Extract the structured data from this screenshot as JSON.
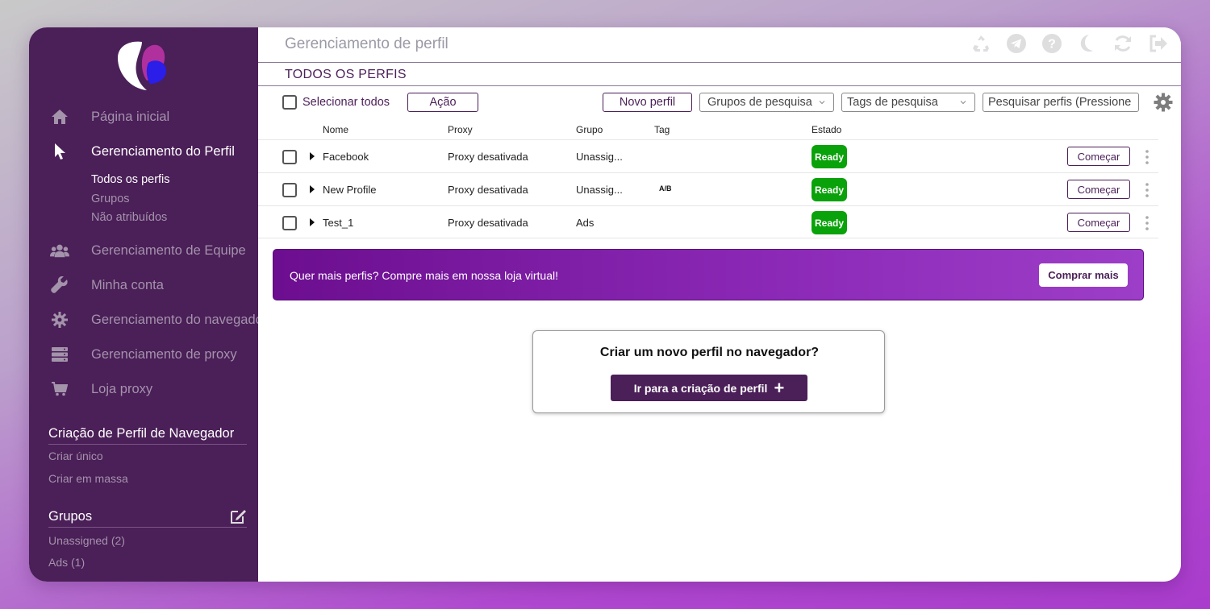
{
  "sidebar": {
    "nav": [
      {
        "label": "Página inicial",
        "icon": "home-icon"
      },
      {
        "label": "Gerenciamento do Perfil",
        "icon": "cursor-icon"
      },
      {
        "label": "Gerenciamento de Equipe",
        "icon": "team-icon"
      },
      {
        "label": "Minha conta",
        "icon": "wrench-icon"
      },
      {
        "label": "Gerenciamento do navegador",
        "icon": "gear-icon"
      },
      {
        "label": "Gerenciamento de proxy",
        "icon": "server-icon"
      },
      {
        "label": "Loja proxy",
        "icon": "cart-icon"
      }
    ],
    "profile_sub": [
      "Todos os perfis",
      "Grupos",
      "Não atribuídos"
    ],
    "create_section": {
      "title": "Criação de Perfil de Navegador",
      "items": [
        "Criar único",
        "Criar em massa"
      ]
    },
    "groups_section": {
      "title": "Grupos",
      "items": [
        "Unassigned (2)",
        "Ads (1)"
      ]
    }
  },
  "header": {
    "title": "Gerenciamento de perfil",
    "section": "TODOS OS PERFIS"
  },
  "toolbar": {
    "select_all": "Selecionar todos",
    "action": "Ação",
    "new_profile": "Novo perfil",
    "search_groups": "Grupos de pesquisa",
    "search_tags": "Tags de pesquisa",
    "search_placeholder": "Pesquisar perfis (Pressione /)"
  },
  "table": {
    "columns": [
      "Nome",
      "Proxy",
      "Grupo",
      "Tag",
      "Estado"
    ],
    "rows": [
      {
        "name": "Facebook",
        "proxy": "Proxy desativada",
        "group": "Unassig...",
        "tag": "",
        "status": "Ready",
        "action": "Começar"
      },
      {
        "name": "New Profile",
        "proxy": "Proxy desativada",
        "group": "Unassig...",
        "tag": "A/B",
        "status": "Ready",
        "action": "Começar"
      },
      {
        "name": "Test_1",
        "proxy": "Proxy desativada",
        "group": "Ads",
        "tag": "",
        "status": "Ready",
        "action": "Começar"
      }
    ]
  },
  "banner": {
    "message": "Quer mais perfis? Compre mais em nossa loja virtual!",
    "button": "Comprar mais"
  },
  "create_card": {
    "question": "Criar um novo perfil no navegador?",
    "button": "Ir para a criação de perfil"
  },
  "colors": {
    "sidebar_bg": "#4b1f58",
    "accent": "#4b1f58",
    "ready_badge": "#0aa20a",
    "banner_start": "#6c0e8f",
    "banner_end": "#9d3ec8"
  }
}
